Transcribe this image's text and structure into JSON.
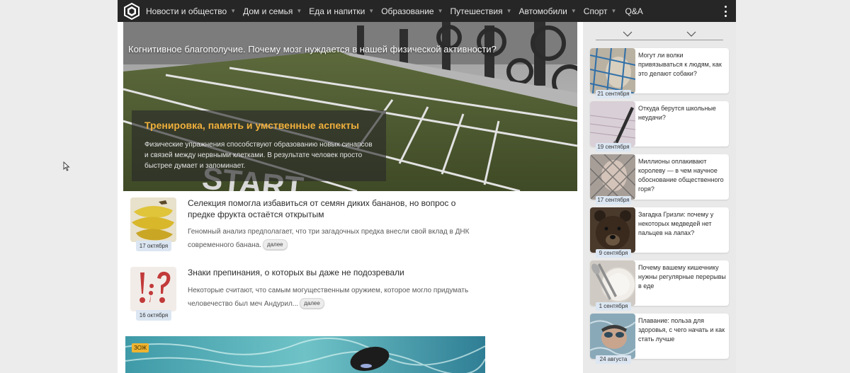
{
  "nav": {
    "items": [
      {
        "label": "Новости и общество"
      },
      {
        "label": "Дом и семья"
      },
      {
        "label": "Еда и напитки"
      },
      {
        "label": "Образование"
      },
      {
        "label": "Путешествия"
      },
      {
        "label": "Автомобили"
      },
      {
        "label": "Спорт"
      }
    ],
    "qa_label": "Q&A"
  },
  "hero": {
    "title": "Когнитивное благополучие. Почему мозг нуждается в нашей физической активности?",
    "box_title": "Тренировка, память и умственные аспекты",
    "box_text": "Физические упражнения способствуют образованию новых синапсов и связей между нервными клетками. В результате человек просто быстрее думает и запоминает."
  },
  "articles": [
    {
      "title": "Селекция помогла избавиться от семян диких бананов, но вопрос о предке фрукта остаётся открытым",
      "excerpt": "Геномный анализ предполагает, что три загадочных предка внесли свой вклад в ДНК современного банана.",
      "date": "17 октября",
      "more": "далее"
    },
    {
      "title": "Знаки препинания, о которых вы даже не подозревали",
      "excerpt": "Некоторые считают, что самым могущественным оружием, которое могло придумать человечество был меч Андурил...",
      "date": "16 октября",
      "more": "далее"
    }
  ],
  "featured_badge": "ЗОЖ",
  "sidebar": {
    "items": [
      {
        "title": "Могут ли волки привязываться к людям, как это делают собаки?",
        "date": "21 сентября"
      },
      {
        "title": "Откуда берутся школьные неудачи?",
        "date": "19 сентября"
      },
      {
        "title": "Миллионы оплакивают королеву — в чем научное обоснование общественного горя?",
        "date": "17 сентября"
      },
      {
        "title": "Загадка Гризли: почему у некоторых медведей нет пальцев на лапах?",
        "date": "9 сентября"
      },
      {
        "title": "Почему вашему кишечнику нужны регулярные перерывы в еде",
        "date": "1 сентября"
      },
      {
        "title": "Плавание: польза для здоровья, с чего начать и как стать лучше",
        "date": "24 августа"
      }
    ]
  },
  "colors": {
    "nav_bg": "#262626",
    "accent": "#f0b03c",
    "date_badge": "#dbe6f2"
  }
}
